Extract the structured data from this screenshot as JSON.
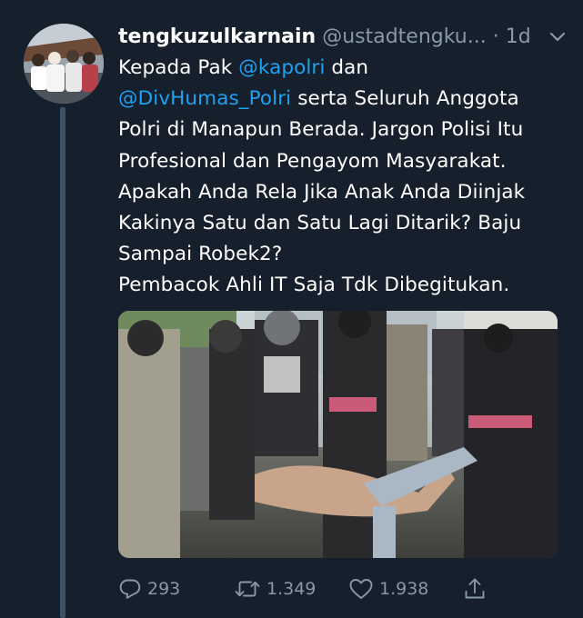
{
  "tweet": {
    "author": {
      "display_name": "tengkuzulkarnain",
      "handle": "@ustadtengku...",
      "separator": "·",
      "time": "1d"
    },
    "text_lines": [
      [
        {
          "text": "Kepada Pak ",
          "type": "text"
        },
        {
          "text": "@kapolri",
          "type": "mention"
        },
        {
          "text": " dan",
          "type": "text"
        }
      ],
      [
        {
          "text": "@DivHumas_Polri",
          "type": "mention"
        },
        {
          "text": " serta Seluruh Anggota",
          "type": "text"
        }
      ],
      [
        {
          "text": "Polri di Manapun Berada. Jargon Polisi Itu",
          "type": "text"
        }
      ],
      [
        {
          "text": "Profesional dan Pengayom Masyarakat.",
          "type": "text"
        }
      ],
      [
        {
          "text": "Apakah Anda Rela Jika Anak Anda Diinjak",
          "type": "text"
        }
      ],
      [
        {
          "text": "Kakinya Satu dan Satu Lagi Ditarik? Baju",
          "type": "text"
        }
      ],
      [
        {
          "text": "Sampai Robek2?",
          "type": "text"
        }
      ],
      [
        {
          "text": "Pembacok Ahli IT Saja Tdk Dibegitukan.",
          "type": "text"
        }
      ]
    ],
    "actions": {
      "reply": {
        "icon": "reply-icon",
        "count": "293"
      },
      "retweet": {
        "icon": "retweet-icon",
        "count": "1.349"
      },
      "like": {
        "icon": "heart-icon",
        "count": "1.938"
      },
      "share": {
        "icon": "share-icon"
      }
    },
    "colors": {
      "background": "#16202c",
      "text": "#ffffff",
      "secondary": "#8899a6",
      "mention": "#1da1f2",
      "thread_line": "#3d5266"
    }
  }
}
